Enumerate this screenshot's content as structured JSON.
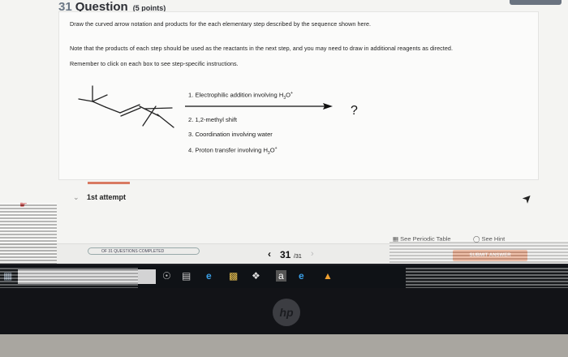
{
  "question": {
    "number": "31",
    "word": "Question",
    "points": "(5 points)"
  },
  "instructions": {
    "line1": "Draw the curved arrow notation and products for the each elementary step described by the sequence shown here.",
    "line2": "Note that the products of each step should be used as the reactants in the next step, and you may need to draw in additional reagents as directed.",
    "line3": "Remember to click on each box to see step-specific instructions."
  },
  "reaction": {
    "step1": "1. Electrophilic addition involving H",
    "step1_sub": "3",
    "step1_mid": "O",
    "step1_sup": "+",
    "step2": "2. 1,2-methyl shift",
    "step3": "3. Coordination involving water",
    "step4": "4. Proton transfer involving H",
    "step4_sub": "3",
    "step4_mid": "O",
    "step4_sup": "+",
    "product": "?"
  },
  "attempt": {
    "label": "1st attempt"
  },
  "tools": {
    "periodic_table": "See Periodic Table",
    "hint": "See Hint"
  },
  "footer": {
    "progress": "OF 31 QUESTIONS COMPLETED",
    "current": "31",
    "total": "/31",
    "submit": "SUBMIT ANSWER"
  },
  "colors": {
    "accent": "#d87a62",
    "submit": "#e8a98c"
  },
  "icons": {
    "chevron": "chevron-down-icon",
    "pencil": "pencil-icon",
    "periodic": "periodic-table-icon",
    "hint": "lightbulb-icon",
    "prev": "chevron-left-icon",
    "next": "chevron-right-icon"
  }
}
